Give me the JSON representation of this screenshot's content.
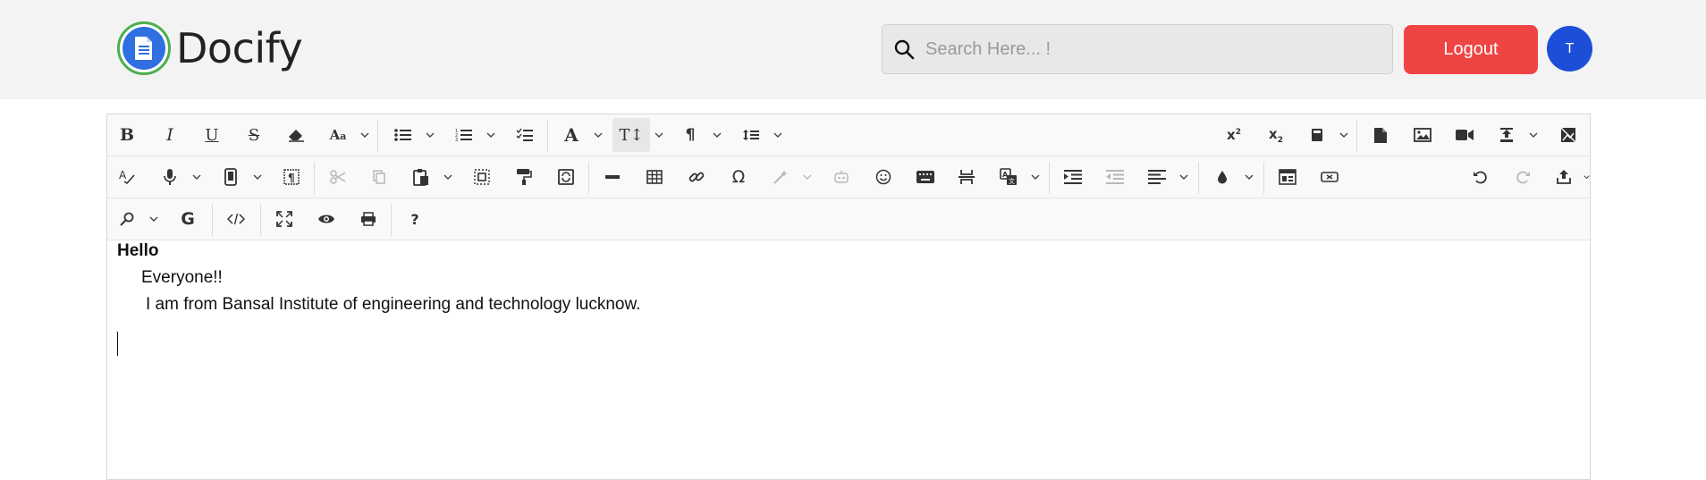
{
  "header": {
    "logo_text": "Docify",
    "search_placeholder": "Search Here... !",
    "logout_label": "Logout",
    "avatar_initial": "T"
  },
  "toolbar": {
    "row1": [
      "bold",
      "italic",
      "underline",
      "strikethrough",
      "eraser",
      "font-size",
      "unordered-list",
      "ordered-list",
      "checklist",
      "font",
      "line-height-text",
      "paragraph",
      "line-height",
      "superscript",
      "subscript",
      "file",
      "image",
      "video",
      "upload"
    ],
    "row2": [
      "spellcheck",
      "microphone",
      "mobile",
      "show-blocks",
      "cut",
      "copy",
      "paste",
      "select-all",
      "format-painter",
      "copy-format",
      "horizontal-rule",
      "table",
      "link",
      "omega-symbol",
      "magic-ai",
      "robot",
      "emoji",
      "keyboard",
      "hr-break",
      "translate",
      "indent",
      "outdent",
      "align",
      "color",
      "preview-layout",
      "button",
      "undo",
      "redo",
      "export"
    ],
    "row3": [
      "search",
      "google",
      "source",
      "fullsize",
      "preview",
      "print",
      "help"
    ],
    "special_glyphs": {
      "omega": "Ω",
      "help": "?",
      "google": "G",
      "bold": "B",
      "italic": "I",
      "underline": "U",
      "strike": "S",
      "font": "A",
      "textsize": "T↕",
      "pilcrow": "¶"
    }
  },
  "document": {
    "lines": [
      "Hello",
      "Everyone!!",
      "I am from Bansal Institute of engineering and technology lucknow."
    ]
  },
  "colors": {
    "logout_bg": "#ef4444",
    "avatar_bg": "#1d4ed8",
    "header_bg": "#f3f3f3"
  }
}
